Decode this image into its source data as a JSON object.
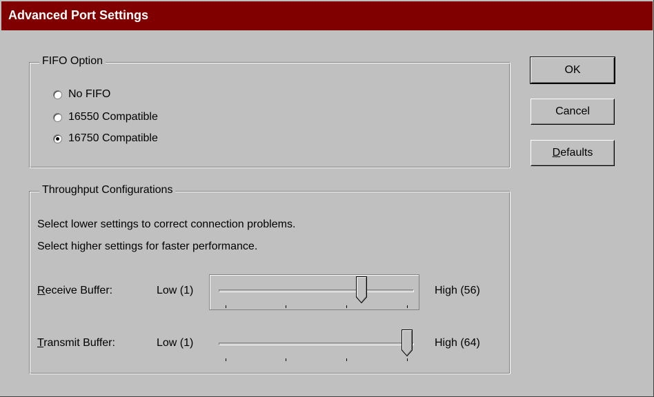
{
  "window": {
    "title": "Advanced Port Settings"
  },
  "fifo": {
    "group_label": "FIFO Option",
    "options": [
      {
        "label": "No FIFO",
        "selected": false
      },
      {
        "label": "16550 Compatible",
        "selected": false
      },
      {
        "label": "16750 Compatible",
        "selected": true
      }
    ]
  },
  "throughput": {
    "group_label": "Throughput Configurations",
    "hint_lower": "Select lower settings to correct connection problems.",
    "hint_higher": "Select higher settings for faster performance.",
    "receive": {
      "label_accel": "R",
      "label_rest": "eceive Buffer:",
      "low_label": "Low (1)",
      "high_label": "High (56)",
      "value_fraction": 0.75
    },
    "transmit": {
      "label_accel": "T",
      "label_rest": "ransmit Buffer:",
      "low_label": "Low (1)",
      "high_label": "High (64)",
      "value_fraction": 1.0
    }
  },
  "buttons": {
    "ok": "OK",
    "cancel": "Cancel",
    "defaults_accel": "D",
    "defaults_rest": "efaults"
  }
}
